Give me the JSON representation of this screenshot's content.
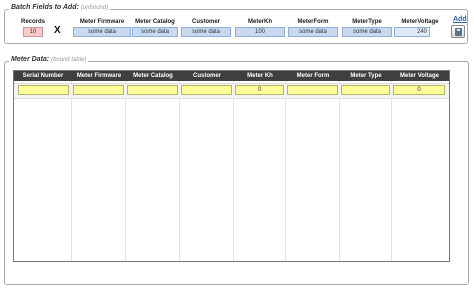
{
  "batch": {
    "legend": "Batch Fields to Add:",
    "legend_sub": "(unbound)",
    "records_label": "Records",
    "records_value": "10",
    "x_label": "X",
    "labels": [
      "Meter Firmware",
      "Meter Catalog",
      "Customer",
      "MeterKh",
      "MeterForm",
      "MeterType",
      "MeterVoltage"
    ],
    "values": [
      "some data",
      "some data",
      "some data",
      "100",
      "some data",
      "some data",
      "240"
    ],
    "add_label": "Add"
  },
  "meter": {
    "legend": "Meter Data:",
    "legend_sub": "(bound table)",
    "columns": [
      "Serial Number",
      "Meter Firmware",
      "Meter Catalog",
      "Customer",
      "Meter Kh",
      "Meter Form",
      "Meter Type",
      "Meter Voltage"
    ],
    "row": [
      "",
      "",
      "",
      "",
      "0",
      "",
      "",
      "0"
    ]
  }
}
